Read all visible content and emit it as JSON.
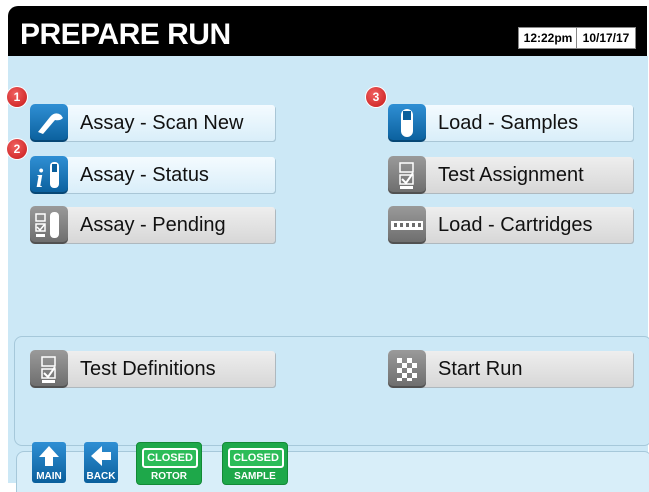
{
  "header": {
    "title": "PREPARE RUN",
    "time": "12:22pm",
    "date": "10/17/17"
  },
  "menu": {
    "left": [
      {
        "label": "Assay - Scan New",
        "icon": "scanner-icon",
        "badge": "1"
      },
      {
        "label": "Assay - Status",
        "icon": "info-tube-icon",
        "badge": "2"
      },
      {
        "label": "Assay - Pending",
        "icon": "checklist-tube-icon"
      }
    ],
    "right": [
      {
        "label": "Load - Samples",
        "icon": "sample-tube-icon",
        "badge": "3"
      },
      {
        "label": "Test Assignment",
        "icon": "checklist-icon"
      },
      {
        "label": "Load - Cartridges",
        "icon": "cartridge-icon"
      }
    ]
  },
  "lower": {
    "test_definitions": "Test Definitions",
    "start_run": "Start Run"
  },
  "footer": {
    "main": "MAIN",
    "back": "BACK",
    "rotor_status": "CLOSED",
    "rotor_label": "ROTOR",
    "sample_status": "CLOSED",
    "sample_label": "SAMPLE"
  },
  "colors": {
    "background": "#cce8f6",
    "titlebar": "#000000",
    "icon_blue": "#0a5f9c",
    "badge_red": "#c81818",
    "status_green": "#1ea84a"
  }
}
